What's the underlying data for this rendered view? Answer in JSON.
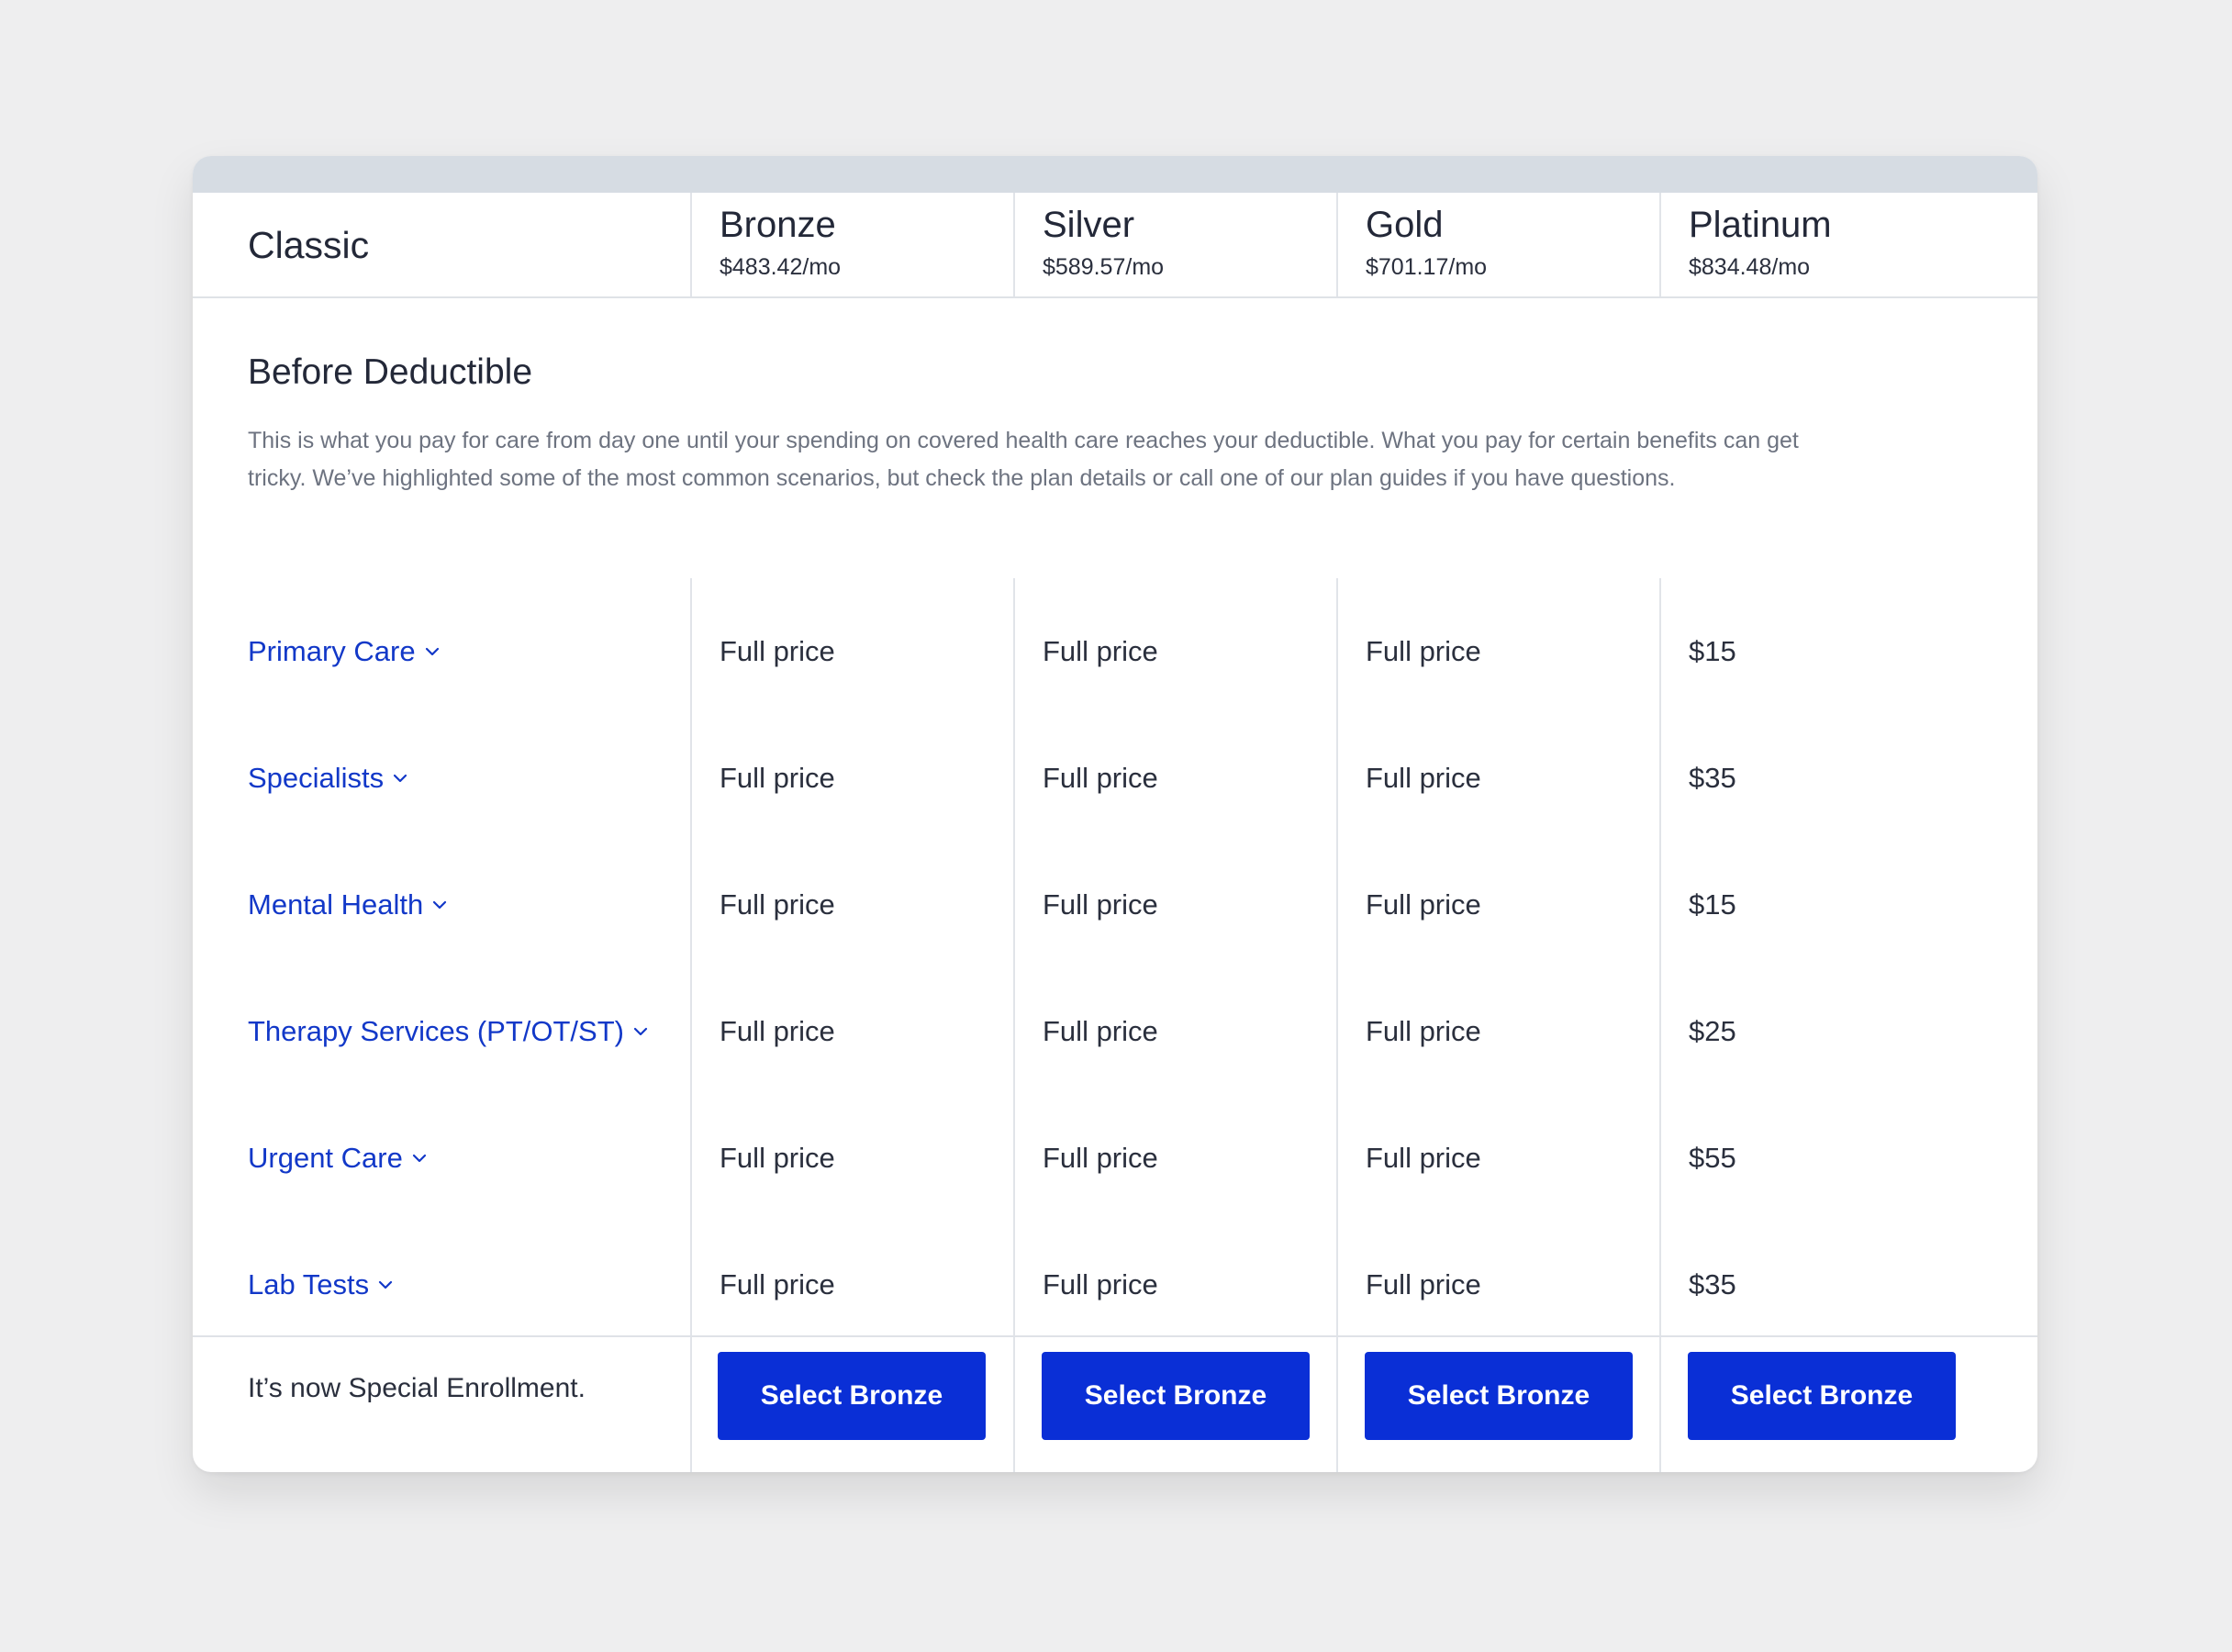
{
  "header": {
    "classic_label": "Classic",
    "plans": [
      {
        "name": "Bronze",
        "price": "$483.42/mo"
      },
      {
        "name": "Silver",
        "price": "$589.57/mo"
      },
      {
        "name": "Gold",
        "price": "$701.17/mo"
      },
      {
        "name": "Platinum",
        "price": "$834.48/mo"
      }
    ]
  },
  "section": {
    "title": "Before Deductible",
    "description": "This is what you pay for care from day one until your spending on covered health care reaches your deductible. What you pay for certain benefits can get tricky. We’ve highlighted some of the most common scenarios, but check the plan details or call one of our plan guides if you have questions."
  },
  "benefits": [
    {
      "label": "Primary Care",
      "values": [
        "Full price",
        "Full price",
        "Full price",
        "$15"
      ]
    },
    {
      "label": "Specialists",
      "values": [
        "Full price",
        "Full price",
        "Full price",
        "$35"
      ]
    },
    {
      "label": "Mental Health",
      "values": [
        "Full price",
        "Full price",
        "Full price",
        "$15"
      ]
    },
    {
      "label": "Therapy Services (PT/OT/ST)",
      "values": [
        "Full price",
        "Full price",
        "Full price",
        "$25"
      ]
    },
    {
      "label": "Urgent Care",
      "values": [
        "Full price",
        "Full price",
        "Full price",
        "$55"
      ]
    },
    {
      "label": "Lab Tests",
      "values": [
        "Full price",
        "Full price",
        "Full price",
        "$35"
      ]
    }
  ],
  "footer": {
    "enrollment_text": "It’s now Special Enrollment.",
    "buttons": [
      "Select Bronze",
      "Select Bronze",
      "Select Bronze",
      "Select Bronze"
    ]
  },
  "icons": {
    "expand": "chevron-down-icon"
  },
  "colors": {
    "accent": "#0a2fd6",
    "link": "#1238c8",
    "page_background": "#eeeeef",
    "header_bar": "#d6dce3"
  }
}
